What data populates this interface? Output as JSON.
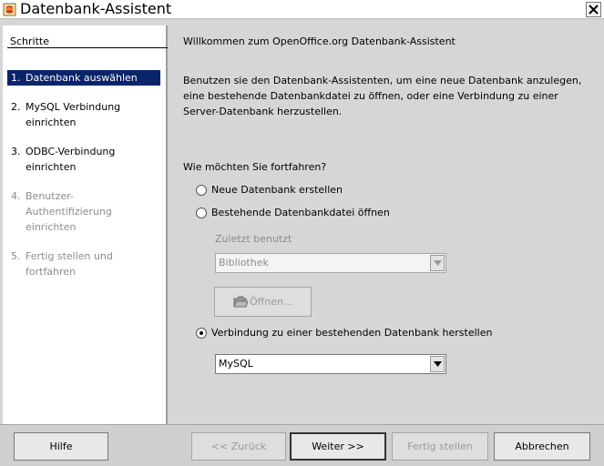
{
  "window": {
    "title": "Datenbank-Assistent",
    "icon": "openoffice-base-icon"
  },
  "sidebar": {
    "title": "Schritte",
    "steps": [
      {
        "num": "1.",
        "label": "Datenbank auswählen",
        "state": "active"
      },
      {
        "num": "2.",
        "label": "MySQL Verbindung einrichten",
        "state": "enabled"
      },
      {
        "num": "3.",
        "label": "ODBC-Verbindung einrichten",
        "state": "enabled"
      },
      {
        "num": "4.",
        "label": "Benutzer-Authentifizierung einrichten",
        "state": "disabled"
      },
      {
        "num": "5.",
        "label": "Fertig stellen und fortfahren",
        "state": "disabled"
      }
    ]
  },
  "main": {
    "welcome": "Willkommen zum OpenOffice.org Datenbank-Assistent",
    "intro": "Benutzen sie den Datenbank-Assistenten, um eine neue Datenbank anzulegen, eine bestehende Datenbankdatei zu öffnen, oder eine Verbindung zu einer Server-Datenbank herzustellen.",
    "question": "Wie möchten Sie fortfahren?",
    "options": {
      "new_db": {
        "label": "Neue Datenbank erstellen",
        "checked": false
      },
      "open_existing": {
        "label": "Bestehende Datenbankdatei öffnen",
        "checked": false
      },
      "connect": {
        "label": "Verbindung zu einer bestehenden Datenbank herstellen",
        "checked": true
      }
    },
    "recent_label": "Zuletzt benutzt",
    "recent_value": "Bibliothek",
    "open_button": "Öffnen...",
    "db_type_value": "MySQL"
  },
  "buttons": {
    "help": "Hilfe",
    "back": "<< Zurück",
    "next": "Weiter >>",
    "finish": "Fertig stellen",
    "cancel": "Abbrechen"
  }
}
